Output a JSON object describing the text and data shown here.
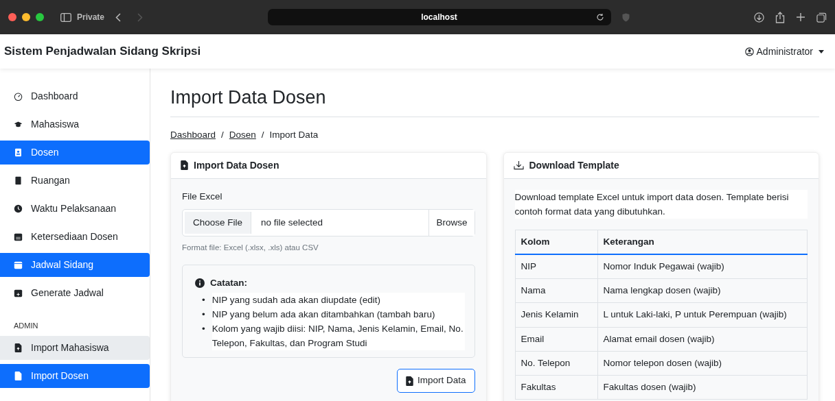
{
  "browser": {
    "tab_label": "Private",
    "url": "localhost"
  },
  "navbar": {
    "brand": "Sistem Penjadwalan Sidang Skripsi",
    "user": "Administrator"
  },
  "sidebar": {
    "items": [
      {
        "label": "Dashboard",
        "selected": false,
        "highlighted": false
      },
      {
        "label": "Mahasiswa",
        "selected": false,
        "highlighted": false
      },
      {
        "label": "Dosen",
        "selected": true,
        "highlighted": false
      },
      {
        "label": "Ruangan",
        "selected": false,
        "highlighted": false
      },
      {
        "label": "Waktu Pelaksanaan",
        "selected": false,
        "highlighted": false
      },
      {
        "label": "Ketersediaan Dosen",
        "selected": false,
        "highlighted": false
      },
      {
        "label": "Jadwal Sidang",
        "selected": true,
        "highlighted": false
      },
      {
        "label": "Generate Jadwal",
        "selected": false,
        "highlighted": false
      }
    ],
    "section_heading": "ADMIN",
    "admin_items": [
      {
        "label": "Import Mahasiswa",
        "selected": false,
        "highlighted": true
      },
      {
        "label": "Import Dosen",
        "selected": true,
        "highlighted": false
      }
    ]
  },
  "page_title": "Import Data Dosen",
  "breadcrumb_separator": "/",
  "breadcrumb": [
    {
      "label": "Dashboard",
      "link": true
    },
    {
      "label": "Dosen",
      "link": true
    },
    {
      "label": "Import Data",
      "link": false
    }
  ],
  "import_card": {
    "title": "Import Data Dosen",
    "field_label": "File Excel",
    "choose_button": "Choose File",
    "file_status": "no file selected",
    "browse_button": "Browse",
    "help": "Format file: Excel (.xlsx, .xls) atau CSV",
    "note_title": "Catatan:",
    "note_marker": "•",
    "notes": [
      "NIP yang sudah ada akan diupdate (edit)",
      "NIP yang belum ada akan ditambahkan (tambah baru)",
      "Kolom yang wajib diisi: NIP, Nama, Jenis Kelamin, Email, No. Telepon, Fakultas, dan Program Studi"
    ],
    "submit_button": "Import Data"
  },
  "template_card": {
    "title": "Download Template",
    "description": "Download template Excel untuk import data dosen. Template berisi contoh format data yang dibutuhkan.",
    "columns": [
      "Kolom",
      "Keterangan"
    ],
    "rows": [
      [
        "NIP",
        "Nomor Induk Pegawai (wajib)"
      ],
      [
        "Nama",
        "Nama lengkap dosen (wajib)"
      ],
      [
        "Jenis Kelamin",
        "L untuk Laki-laki, P untuk Perempuan (wajib)"
      ],
      [
        "Email",
        "Alamat email dosen (wajib)"
      ],
      [
        "No. Telepon",
        "Nomor telepon dosen (wajib)"
      ],
      [
        "Fakultas",
        "Fakultas dosen (wajib)"
      ]
    ]
  }
}
